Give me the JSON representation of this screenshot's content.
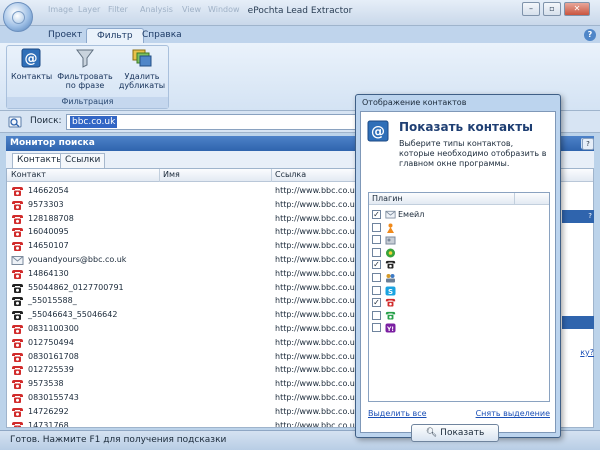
{
  "window": {
    "title": "ePochta Lead Extractor",
    "quick_items": [
      "Image",
      "Layer",
      "Filter",
      "Analysis",
      "View",
      "Window"
    ]
  },
  "ribbon": {
    "tabs": [
      {
        "label": "Проект",
        "active": false
      },
      {
        "label": "Фильтр",
        "active": true
      },
      {
        "label": "Справка",
        "active": false
      }
    ],
    "group_label": "Фильтрация",
    "buttons": [
      {
        "label1": "Контакты",
        "label2": ""
      },
      {
        "label1": "Фильтровать",
        "label2": "по фразе"
      },
      {
        "label1": "Удалить",
        "label2": "дубликаты"
      }
    ]
  },
  "search": {
    "label": "Поиск:",
    "value": "bbc.co.uk"
  },
  "panel": {
    "title": "Монитор поиска",
    "tabs": [
      "Контакты",
      "Ссылки"
    ],
    "columns": [
      "Контакт",
      "Имя",
      "Ссылка"
    ],
    "rows": [
      {
        "contact": "14662054",
        "icon": "red-phone",
        "link": "http://www.bbc.co.uk"
      },
      {
        "contact": "9573303",
        "icon": "red-phone",
        "link": "http://www.bbc.co.uk"
      },
      {
        "contact": "128188708",
        "icon": "red-phone",
        "link": "http://www.bbc.co.uk"
      },
      {
        "contact": "16040095",
        "icon": "red-phone",
        "link": "http://www.bbc.co.uk"
      },
      {
        "contact": "14650107",
        "icon": "red-phone",
        "link": "http://www.bbc.co.uk"
      },
      {
        "contact": "youandyours@bbc.co.uk",
        "icon": "envelope",
        "link": "http://www.bbc.co.uk"
      },
      {
        "contact": "14864130",
        "icon": "red-phone",
        "link": "http://www.bbc.co.uk"
      },
      {
        "contact": "55044862_0127700791",
        "icon": "black-phone",
        "link": "http://www.bbc.co.uk"
      },
      {
        "contact": "_55015588_",
        "icon": "black-phone",
        "link": "http://www.bbc.co.uk"
      },
      {
        "contact": "_55046643_55046642",
        "icon": "black-phone",
        "link": "http://www.bbc.co.uk"
      },
      {
        "contact": "0831100300",
        "icon": "red-phone",
        "link": "http://www.bbc.co.uk"
      },
      {
        "contact": "012750494",
        "icon": "red-phone",
        "link": "http://www.bbc.co.uk"
      },
      {
        "contact": "0830161708",
        "icon": "red-phone",
        "link": "http://www.bbc.co.uk"
      },
      {
        "contact": "012725539",
        "icon": "red-phone",
        "link": "http://www.bbc.co.uk"
      },
      {
        "contact": "9573538",
        "icon": "red-phone",
        "link": "http://www.bbc.co.uk"
      },
      {
        "contact": "0830155743",
        "icon": "red-phone",
        "link": "http://www.bbc.co.uk"
      },
      {
        "contact": "14726292",
        "icon": "red-phone",
        "link": "http://www.bbc.co.uk"
      },
      {
        "contact": "14731768",
        "icon": "red-phone",
        "link": "http://www.bbc.co.uk"
      }
    ],
    "side_text": "ку?"
  },
  "status": {
    "text": "Готов. Нажмите F1 для получения подсказки"
  },
  "dialog": {
    "title": "Отображение контактов",
    "heading": "Показать контакты",
    "description": "Выберите типы контактов, которые необходимо отобразить в главном окне программы.",
    "list_header": "Плагин",
    "plugins": [
      {
        "label": "Емейл",
        "checked": true,
        "icon": "envelope"
      },
      {
        "label": "",
        "checked": false,
        "icon": "orange-person"
      },
      {
        "label": "",
        "checked": false,
        "icon": "gray-contact"
      },
      {
        "label": "",
        "checked": false,
        "icon": "green-flower"
      },
      {
        "label": "",
        "checked": true,
        "icon": "black-phone"
      },
      {
        "label": "",
        "checked": false,
        "icon": "people-group"
      },
      {
        "label": "",
        "checked": false,
        "icon": "skype"
      },
      {
        "label": "",
        "checked": true,
        "icon": "red-phone"
      },
      {
        "label": "",
        "checked": false,
        "icon": "green-phone"
      },
      {
        "label": "",
        "checked": false,
        "icon": "yahoo"
      }
    ],
    "select_all": "Выделить все",
    "deselect": "Снять выделение",
    "show_button": "Показать"
  },
  "colors": {
    "accent": "#2f64ad",
    "selection": "#3266c5"
  }
}
